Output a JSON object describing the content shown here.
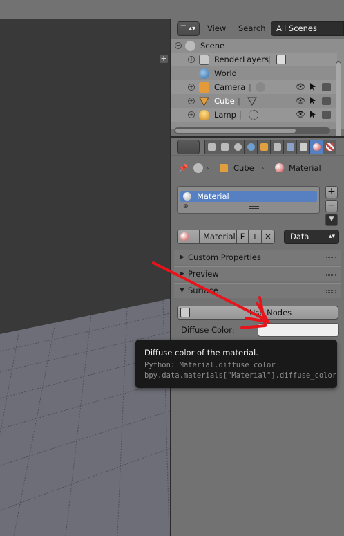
{
  "outliner": {
    "view_label": "View",
    "search_label": "Search",
    "scenes_dropdown": "All Scenes",
    "tree": [
      {
        "label": "Scene"
      },
      {
        "label": "RenderLayers"
      },
      {
        "label": "World"
      },
      {
        "label": "Camera"
      },
      {
        "label": "Cube"
      },
      {
        "label": "Lamp"
      }
    ]
  },
  "properties": {
    "breadcrumb": {
      "object": "Cube",
      "material": "Material"
    },
    "material_slots": [
      {
        "name": "Material"
      }
    ],
    "datablock": {
      "name": "Material",
      "fake_user": "F",
      "link": "Data"
    },
    "panels": {
      "custom_properties": "Custom Properties",
      "preview": "Preview",
      "surface": "Surface"
    },
    "use_nodes_label": "Use Nodes",
    "diffuse_label": "Diffuse Color:",
    "diffuse_color": "#efefef"
  },
  "tooltip": {
    "title": "Diffuse color of the material.",
    "python_line": "Python: Material.diffuse_color",
    "data_path": "bpy.data.materials[\"Material\"].diffuse_color"
  },
  "colors": {
    "selection": "#5680c2",
    "arrow": "#e8141c",
    "viewport_bg": "#393939",
    "grid_plane": "#6e6e78"
  }
}
